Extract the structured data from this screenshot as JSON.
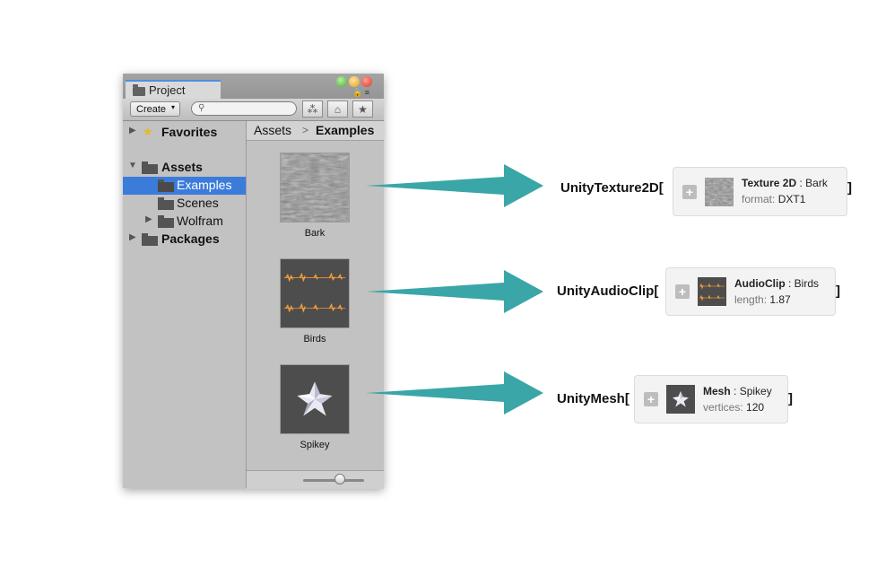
{
  "window": {
    "tab_label": "Project",
    "toolbar": {
      "create_label": "Create",
      "create_caret": "▾",
      "search_placeholder": ""
    },
    "tree": {
      "favorites": "Favorites",
      "assets": "Assets",
      "examples": "Examples",
      "scenes": "Scenes",
      "wolfram": "Wolfram",
      "packages": "Packages"
    },
    "breadcrumb": {
      "root": "Assets",
      "separator": ">",
      "current": "Examples"
    },
    "assets": [
      {
        "name": "Bark"
      },
      {
        "name": "Birds"
      },
      {
        "name": "Spikey"
      }
    ]
  },
  "results": [
    {
      "expression": "UnityTexture2D[",
      "type": "Texture 2D",
      "sep": " : ",
      "name": "Bark",
      "prop_label": "format: ",
      "prop_value": "DXT1"
    },
    {
      "expression": "UnityAudioClip[",
      "type": "AudioClip",
      "sep": " : ",
      "name": "Birds",
      "prop_label": "length: ",
      "prop_value": "1.87"
    },
    {
      "expression": "UnityMesh[",
      "type": "Mesh",
      "sep": " : ",
      "name": "Spikey",
      "prop_label": "vertices: ",
      "prop_value": "120"
    }
  ],
  "closing_bracket": "]",
  "plus_glyph": "+",
  "colors": {
    "arrow": "#3aa6a7",
    "selection": "#3b7cda",
    "tab_accent": "#4f8de6"
  }
}
